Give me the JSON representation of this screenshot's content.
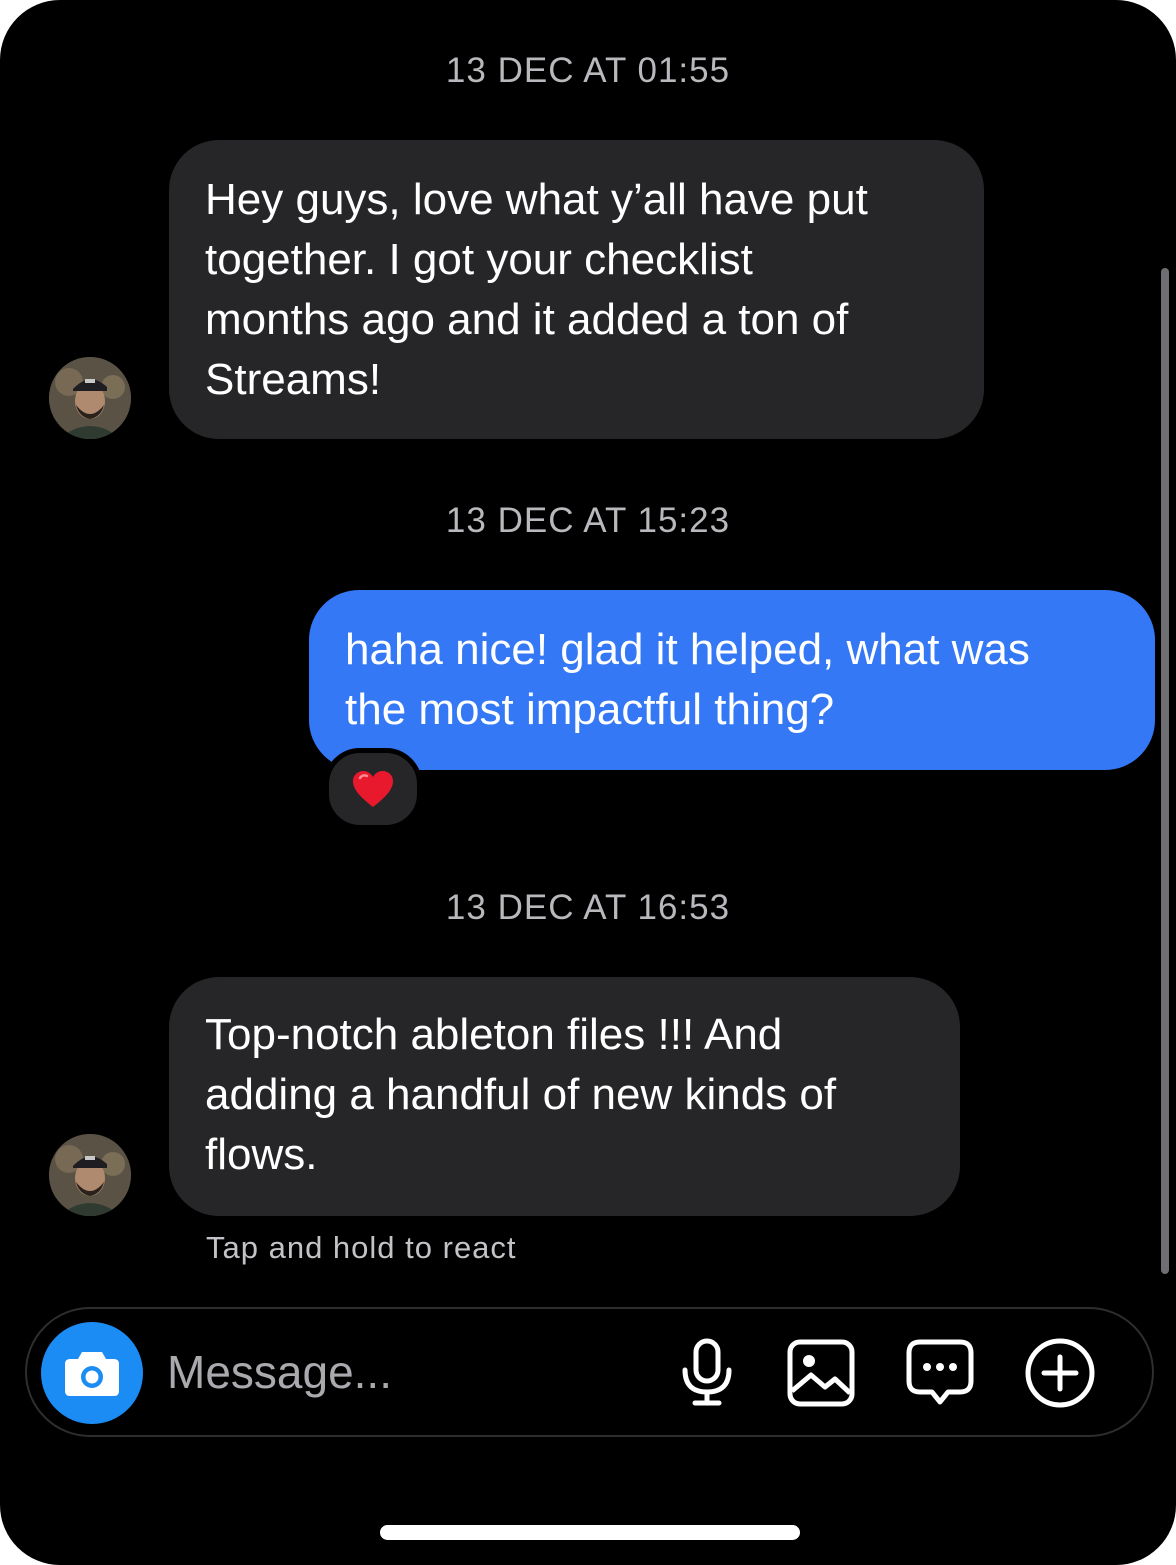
{
  "conversation": {
    "messages": [
      {
        "timestamp": "13 DEC AT 01:55",
        "direction": "incoming",
        "text": "Hey guys, love what y’all have put\ntogether. I got your checklist\nmonths ago and it added a ton of\nStreams!"
      },
      {
        "timestamp": "13 DEC AT 15:23",
        "direction": "outgoing",
        "text": "haha nice! glad it helped, what was\nthe most impactful thing?",
        "reaction": "❤️"
      },
      {
        "timestamp": "13 DEC AT 16:53",
        "direction": "incoming",
        "text": "Top-notch ableton files !!!  And\nadding a handful of new kinds of\nflows."
      }
    ],
    "hint": "Tap and hold to react"
  },
  "composer": {
    "placeholder": "Message...",
    "icons": [
      "camera-icon",
      "microphone-icon",
      "gallery-icon",
      "sticker-chat-icon",
      "plus-circle-icon"
    ]
  },
  "colors": {
    "background": "#000000",
    "incoming_bubble": "#262628",
    "outgoing_bubble": "#3478f6",
    "camera_button": "#1c8cf5",
    "timestamp_text": "#b8b8bd"
  }
}
